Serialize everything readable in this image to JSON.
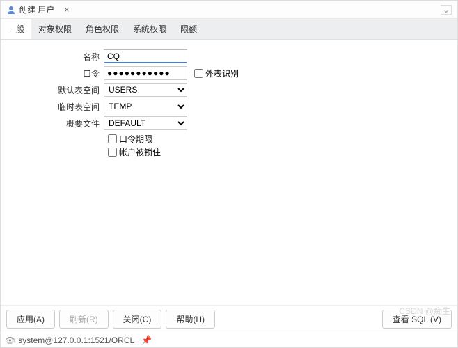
{
  "titleBar": {
    "title": "创建 用户",
    "closeGlyph": "×",
    "chevronGlyph": "⌄"
  },
  "tabs": [
    {
      "label": "一般",
      "selected": true
    },
    {
      "label": "对象权限",
      "selected": false
    },
    {
      "label": "角色权限",
      "selected": false
    },
    {
      "label": "系统权限",
      "selected": false
    },
    {
      "label": "限额",
      "selected": false
    }
  ],
  "form": {
    "nameLabel": "名称",
    "nameValue": "CQ",
    "passwordLabel": "口令",
    "passwordValue": "●●●●●●●●●●●",
    "externalLabel": "外表识别",
    "defaultTablespaceLabel": "默认表空间",
    "defaultTablespaceValue": "USERS",
    "tempTablespaceLabel": "临时表空间",
    "tempTablespaceValue": "TEMP",
    "profileLabel": "概要文件",
    "profileValue": "DEFAULT",
    "passwordExpireLabel": "口令期限",
    "accountLockedLabel": "帐户被锁住"
  },
  "buttons": {
    "apply": "应用(A)",
    "refresh": "刷新(R)",
    "close": "关闭(C)",
    "help": "帮助(H)",
    "viewSql": "查看 SQL (V)"
  },
  "statusBar": {
    "connection": "system@127.0.0.1:1521/ORCL"
  },
  "watermark": "CSDN @痴生"
}
